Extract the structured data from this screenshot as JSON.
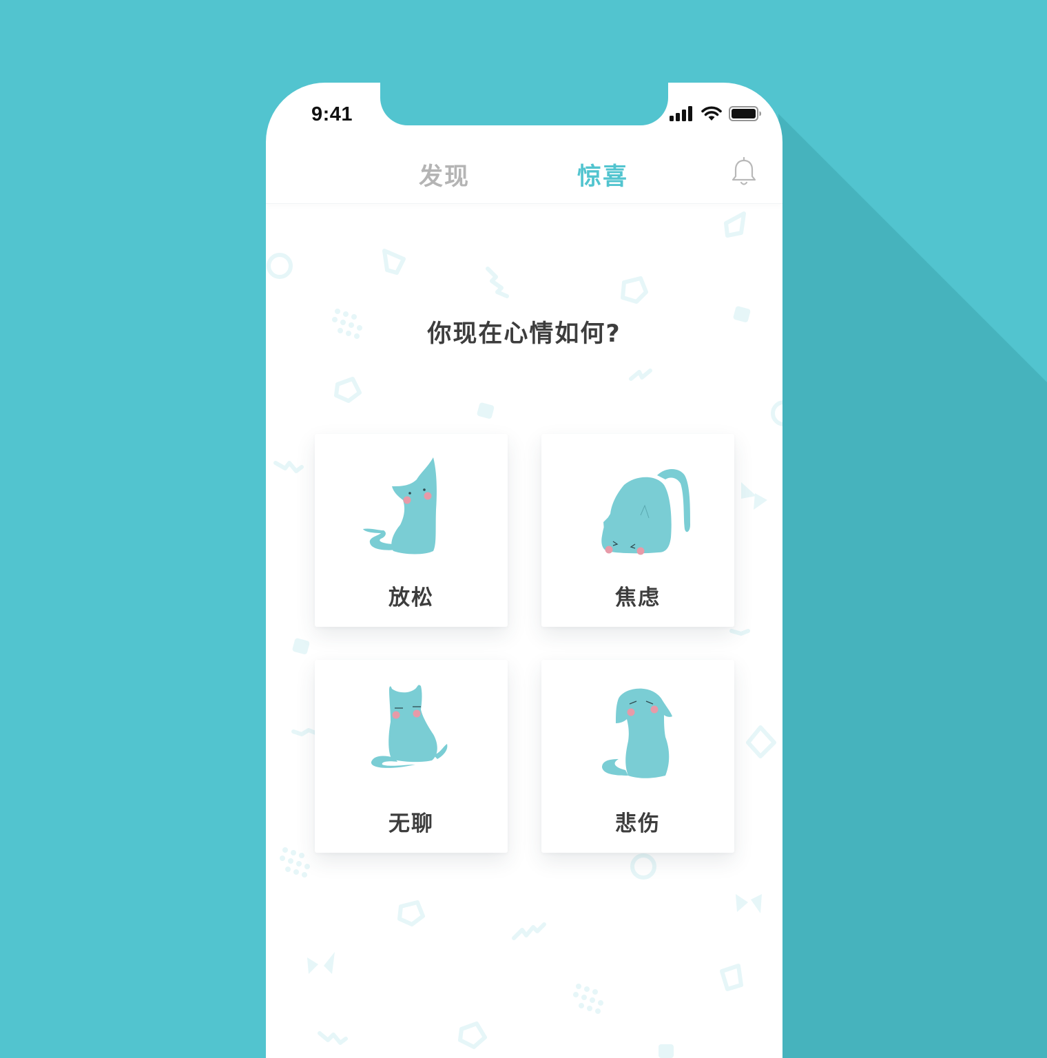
{
  "colors": {
    "background": "#52C4CF",
    "accent": "#52C4CF",
    "cat": "#7ACDD4",
    "blush": "#E79AA8",
    "tab_inactive": "#b4b4b4",
    "text_dark": "#3d3d3d"
  },
  "status_bar": {
    "time": "9:41",
    "icons": [
      "signal-icon",
      "wifi-icon",
      "battery-icon"
    ]
  },
  "nav": {
    "tabs": [
      {
        "label": "发现",
        "active": false
      },
      {
        "label": "惊喜",
        "active": true
      }
    ],
    "right_icon": "bell-icon"
  },
  "main": {
    "question": "你现在心情如何?",
    "moods": [
      {
        "label": "放松",
        "icon": "relaxed-cat-icon"
      },
      {
        "label": "焦虑",
        "icon": "anxious-cat-icon"
      },
      {
        "label": "无聊",
        "icon": "bored-cat-icon"
      },
      {
        "label": "悲伤",
        "icon": "sad-cat-icon"
      }
    ]
  }
}
